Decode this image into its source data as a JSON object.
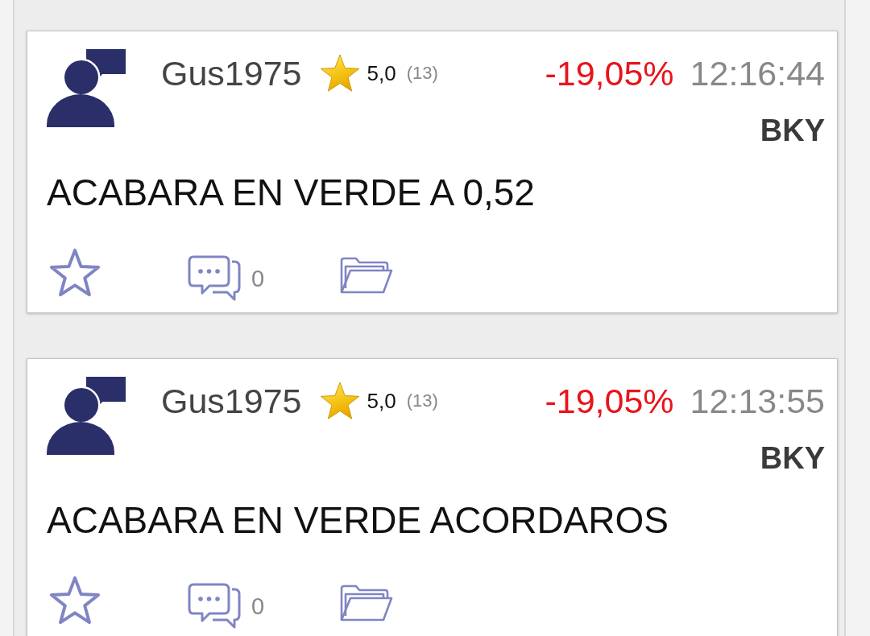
{
  "posts": [
    {
      "user": "Gus1975",
      "rating": "5,0",
      "reviews": "(13)",
      "change": "-19,05%",
      "negative": true,
      "time": "12:16:44",
      "ticker": "BKY",
      "message": "ACABARA EN VERDE A 0,52",
      "favorited": false,
      "comments": "0"
    },
    {
      "user": "Gus1975",
      "rating": "5,0",
      "reviews": "(13)",
      "change": "-19,05%",
      "negative": true,
      "time": "12:13:55",
      "ticker": "BKY",
      "message": "ACABARA EN VERDE ACORDAROS",
      "favorited": false,
      "comments": "0"
    }
  ]
}
